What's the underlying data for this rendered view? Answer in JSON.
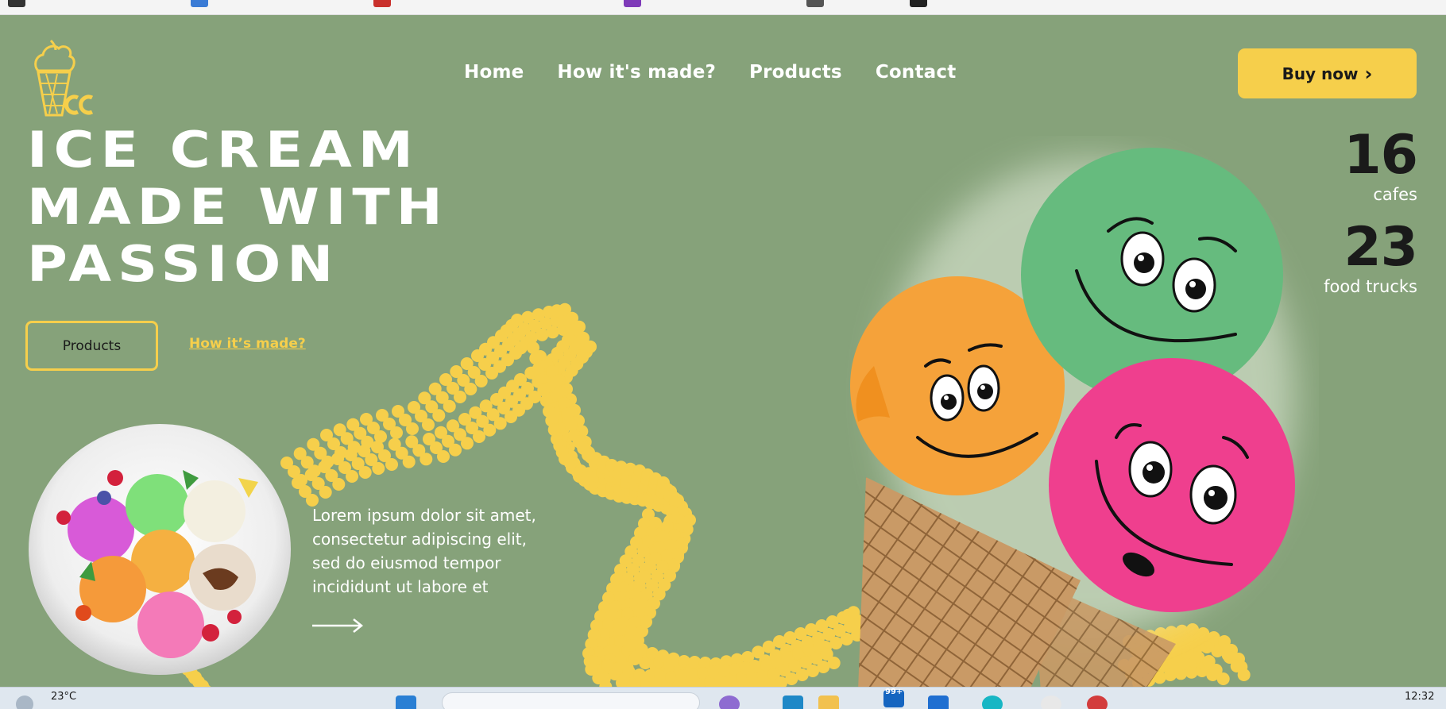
{
  "nav": {
    "items": [
      "Home",
      "How it's made?",
      "Products",
      "Contact"
    ]
  },
  "header": {
    "buy_label": "Buy now",
    "buy_chevron": "›"
  },
  "hero": {
    "headline_lines": [
      "ICE CREAM",
      "MADE WITH",
      "PASSION"
    ],
    "products_button": "Products",
    "how_link": "How it’s made?",
    "lorem_lines": [
      "Lorem ipsum dolor sit amet,",
      "consectetur adipiscing elit,",
      "sed do eiusmod tempor",
      "incididunt ut labore et"
    ]
  },
  "stats": [
    {
      "value": "16",
      "label": "cafes"
    },
    {
      "value": "23",
      "label": "food trucks"
    }
  ],
  "taskbar": {
    "weather": "23°C",
    "clock": "12:32",
    "badge": "99+"
  },
  "colors": {
    "background": "#86a27a",
    "accent": "#f6cf4b",
    "text_dark": "#1a1a1a",
    "scoop_green": "#66bb7e",
    "scoop_orange": "#f5a23a",
    "scoop_pink": "#ef3f8e",
    "cone": "#c79a63"
  },
  "icons": {
    "logo": "ice-cream-cone-logo",
    "cta_chevron": "chevron-right-icon",
    "lorem_arrow": "arrow-right-icon"
  }
}
